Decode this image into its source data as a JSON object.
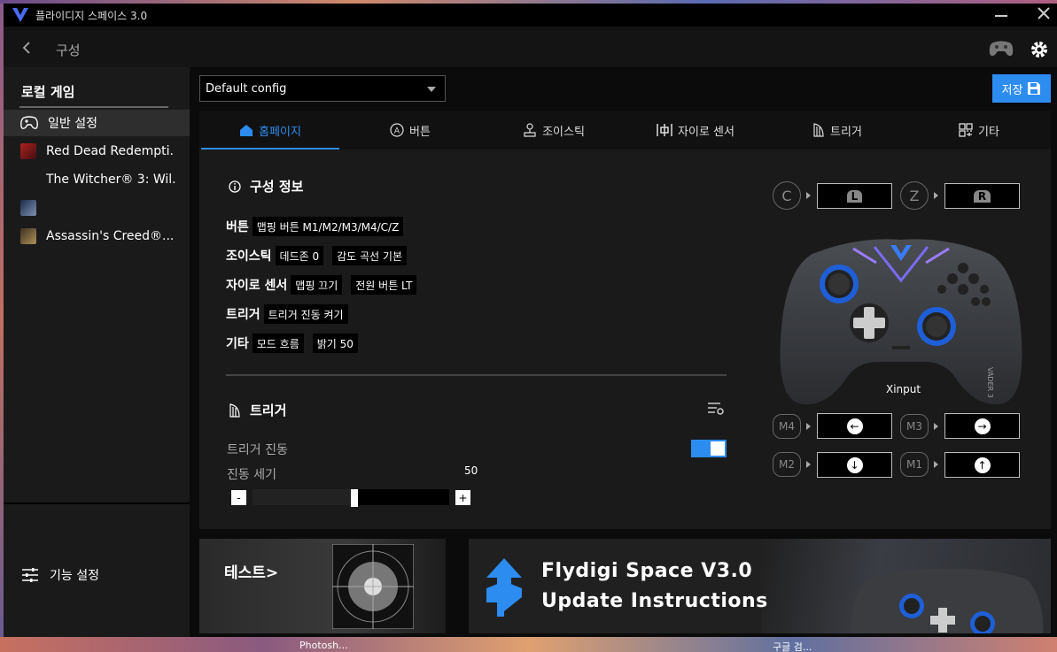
{
  "window": {
    "title": "플라이디지 스페이스 3.0"
  },
  "nav": {
    "title": "구성"
  },
  "sidebar": {
    "heading": "로컬 게임",
    "items": [
      {
        "label": "일반 설정"
      },
      {
        "label": "Red Dead Redempti."
      },
      {
        "label": "The Witcher® 3: Wil."
      },
      {
        "label": ""
      },
      {
        "label": "Assassin's Creed®..."
      }
    ],
    "footer_label": "기능 설정"
  },
  "config": {
    "selected": "Default config"
  },
  "save_label": "저장",
  "tabs": [
    {
      "label": "홈페이지",
      "icon": "home-icon"
    },
    {
      "label": "버튼",
      "icon": "a-button-icon"
    },
    {
      "label": "조이스틱",
      "icon": "joystick-icon"
    },
    {
      "label": "자이로 센서",
      "icon": "gyro-icon"
    },
    {
      "label": "트리거",
      "icon": "trigger-icon"
    },
    {
      "label": "기타",
      "icon": "grid-icon"
    }
  ],
  "config_info": {
    "title": "구성 정보",
    "rows": [
      {
        "label": "버튼",
        "tags": [
          "맵핑 버튼 M1/M2/M3/M4/C/Z"
        ]
      },
      {
        "label": "조이스틱",
        "tags": [
          "데드존 0",
          "감도 곡선 기본"
        ]
      },
      {
        "label": "자이로 센서",
        "tags": [
          "맵핑 끄기",
          "전원 버튼  LT"
        ]
      },
      {
        "label": "트리거",
        "tags": [
          "트리거 진동 켜기"
        ]
      },
      {
        "label": "기타",
        "tags": [
          "모드 흐름",
          "밝기 50"
        ]
      }
    ]
  },
  "trigger": {
    "title": "트리거",
    "vibration_label": "트리거 진동",
    "vibration_on": true,
    "strength_label": "진동 세기",
    "strength_value": "50",
    "strength_fraction": 0.5,
    "minus": "-",
    "plus": "+"
  },
  "controller": {
    "model_label": "Xinput",
    "side_text": "VADER 3",
    "mappings": {
      "c": {
        "label": "C",
        "target": "L"
      },
      "z": {
        "label": "Z",
        "target": "R"
      },
      "m4": {
        "label": "M4",
        "target": "←"
      },
      "m3": {
        "label": "M3",
        "target": "→"
      },
      "m2": {
        "label": "M2",
        "target": "↓"
      },
      "m1": {
        "label": "M1",
        "target": "↑"
      }
    }
  },
  "banners": {
    "test_label": "테스트>",
    "update_line1": "Flydigi Space V3.0",
    "update_line2": "Update Instructions"
  },
  "taskbar": {
    "left": "Photosh...",
    "right": "구글 검..."
  },
  "colors": {
    "accent": "#2d8cf0",
    "background": "#0b0b0b",
    "panel": "#1a1a1a"
  }
}
